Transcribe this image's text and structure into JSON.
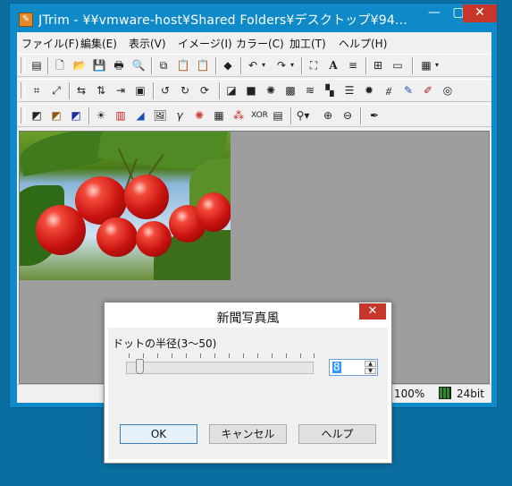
{
  "window": {
    "title": "JTrim - ¥¥vmware-host¥Shared Folders¥デスクトップ¥94...",
    "app_icon": "jtrim-app-icon",
    "controls": {
      "minimize": "—",
      "maximize": "▢",
      "close": "✕"
    }
  },
  "menu": {
    "items": [
      {
        "label": "ファイル(F)"
      },
      {
        "label": "編集(E)"
      },
      {
        "label": "表示(V)"
      },
      {
        "label": "イメージ(I)"
      },
      {
        "label": "カラー(C)"
      },
      {
        "label": "加工(T)"
      },
      {
        "label": "ヘルプ(H)"
      }
    ]
  },
  "toolbar": {
    "row1": [
      "capture-icon",
      "new-icon",
      "open-icon",
      "save-icon",
      "print-icon",
      "print-preview-icon",
      "copy-icon",
      "paste-icon",
      "paste-new-icon",
      "bucket-icon",
      "undo-icon",
      "undo-dropdown-icon",
      "redo-icon",
      "redo-dropdown-icon",
      "fit-icon",
      "text-icon",
      "align-icon",
      "grid-icon",
      "film-icon",
      "palette-icon",
      "palette-dropdown-icon"
    ],
    "row2": [
      "crop-icon",
      "resize-icon",
      "flip-horizontal-icon",
      "flip-vertical-icon",
      "rotate-fit-icon",
      "frame-icon",
      "rotate-90-left-icon",
      "rotate-90-right-icon",
      "rotate-free-icon",
      "shadow-icon",
      "shadow2-icon",
      "burst-icon",
      "mosaic-icon",
      "wave-icon",
      "tile-icon",
      "scanline-icon",
      "sphere-icon",
      "glass-icon",
      "pen-icon",
      "marker-icon",
      "swirl-icon"
    ],
    "row3": [
      "gray-icon",
      "sepia-icon",
      "negative-icon",
      "brightness-icon",
      "color-balance-icon",
      "rgb-icon",
      "image-icon",
      "gamma-icon",
      "hue-icon",
      "checker-icon",
      "rgb-channels-icon",
      "xor-icon",
      "gradient-icon",
      "zoom-dropdown-icon",
      "zoom-in-icon",
      "zoom-out-icon",
      "eyedropper-icon"
    ]
  },
  "status": {
    "zoom": "100%",
    "bitdepth": "24bit"
  },
  "dialog": {
    "title": "新聞写真風",
    "close": "✕",
    "label": "ドットの半径(3〜50)",
    "slider_fraction": 0.1,
    "value": "8",
    "ok": "OK",
    "cancel": "キャンセル",
    "help": "ヘルプ"
  }
}
